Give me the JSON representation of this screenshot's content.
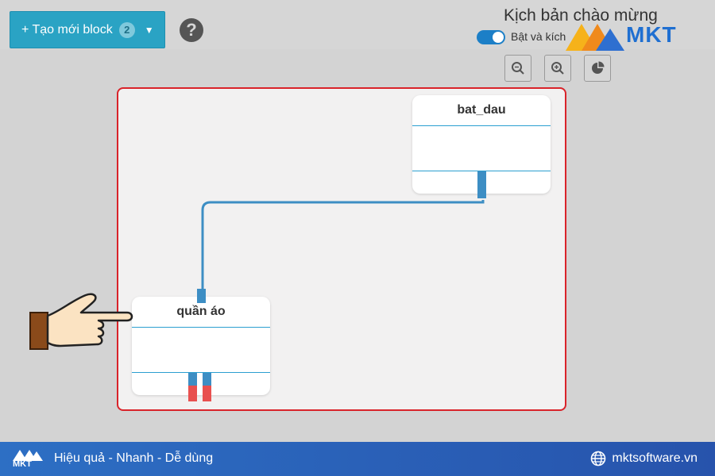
{
  "toolbar": {
    "create_label": "+ Tạo mới block",
    "create_count": "2",
    "help_icon": "question-icon"
  },
  "scenario": {
    "title": "Kịch bản chào mừng",
    "toggle_label": "Bật và kích",
    "toggle_on": true
  },
  "logo": {
    "text": "MKT"
  },
  "zoom_buttons": [
    "zoom-out-icon",
    "zoom-in-icon",
    "fit-icon"
  ],
  "blocks": [
    {
      "title": "bat_dau"
    },
    {
      "title": "quần áo"
    }
  ],
  "footer": {
    "tagline": "Hiệu quả - Nhanh - Dễ dùng",
    "website": "mktsoftware.vn",
    "logo_text": "MKT"
  },
  "colors": {
    "accent": "#2aa3c4",
    "canvas_border": "#d9232a",
    "connector": "#3d8ec4",
    "port_red": "#e8504f",
    "footer": "#2d6fc4",
    "brand": "#1f6fd1"
  }
}
